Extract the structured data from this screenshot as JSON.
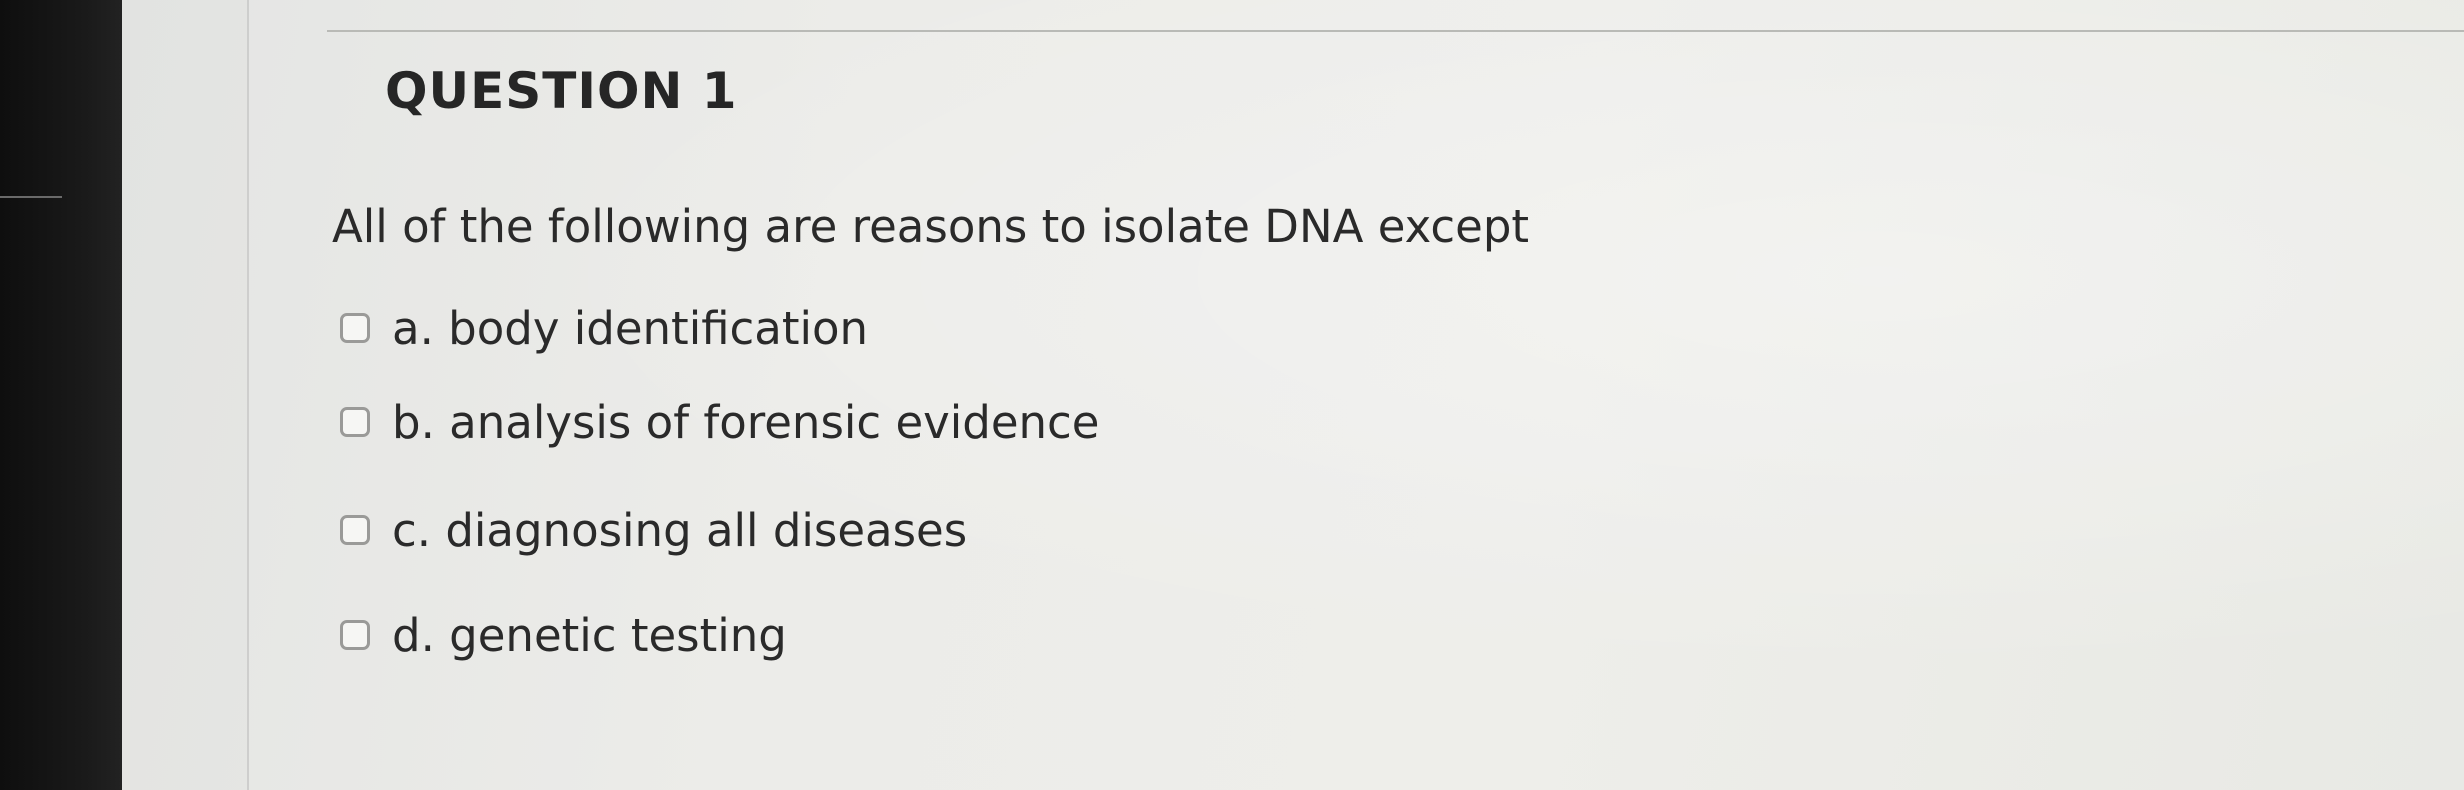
{
  "question": {
    "title": "QUESTION 1",
    "prompt": "All of the following are reasons to isolate DNA except",
    "options": [
      {
        "label": "a. body identification",
        "checked": false
      },
      {
        "label": "b. analysis of forensic evidence",
        "checked": false
      },
      {
        "label": "c. diagnosing all diseases",
        "checked": false
      },
      {
        "label": "d. genetic testing",
        "checked": false
      }
    ]
  }
}
